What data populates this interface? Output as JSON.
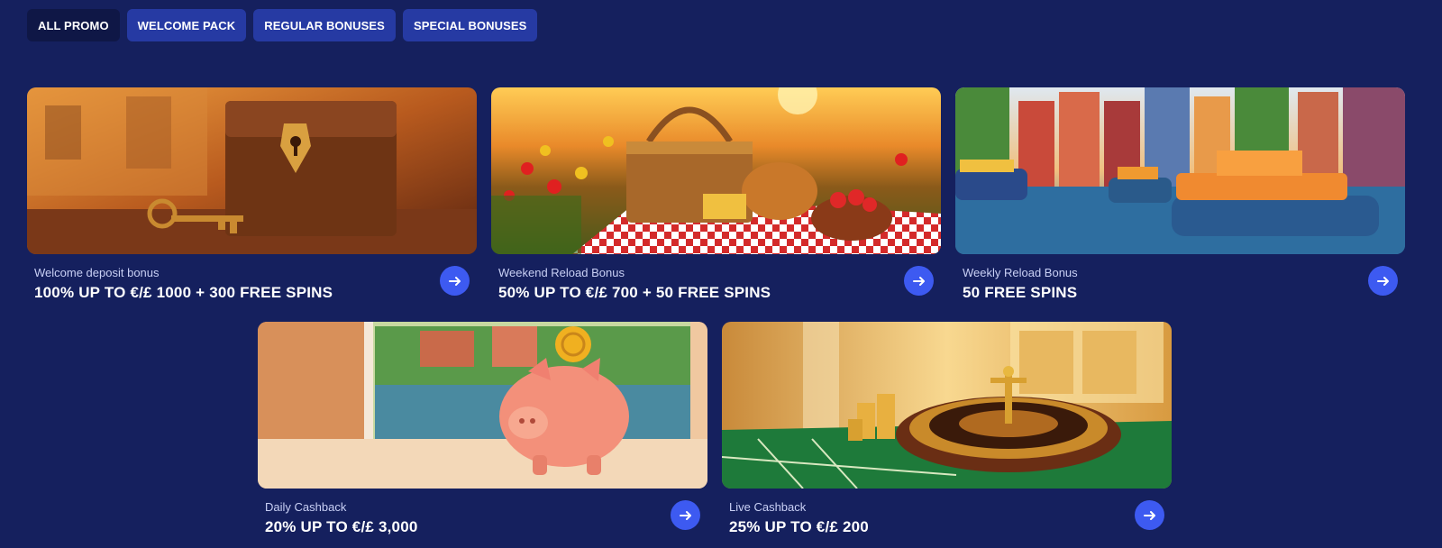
{
  "tabs": [
    {
      "label": "ALL PROMO",
      "active": true
    },
    {
      "label": "WELCOME PACK",
      "active": false
    },
    {
      "label": "REGULAR BONUSES",
      "active": false
    },
    {
      "label": "SPECIAL BONUSES",
      "active": false
    }
  ],
  "promos": [
    {
      "subtitle": "Welcome deposit bonus",
      "title": "100% UP TO €/£ 1000 + 300 FREE SPINS",
      "image": "treasure-chest-with-key"
    },
    {
      "subtitle": "Weekend Reload Bonus",
      "title": "50% UP TO €/£ 700 + 50 FREE SPINS",
      "image": "picnic-basket-in-field"
    },
    {
      "subtitle": "Weekly Reload Bonus",
      "title": "50 FREE SPINS",
      "image": "canal-boats-city"
    },
    {
      "subtitle": "Daily Cashback",
      "title": "20% UP TO €/£ 3,000",
      "image": "piggy-bank-by-window"
    },
    {
      "subtitle": "Live Cashback",
      "title": "25% UP TO €/£ 200",
      "image": "roulette-wheel-table"
    }
  ],
  "colors": {
    "background": "#15205e",
    "tab": "#263aa3",
    "tab_active": "#0f1746",
    "accent": "#3d5af1"
  },
  "icons": {
    "card_action": "arrow-right-icon"
  }
}
